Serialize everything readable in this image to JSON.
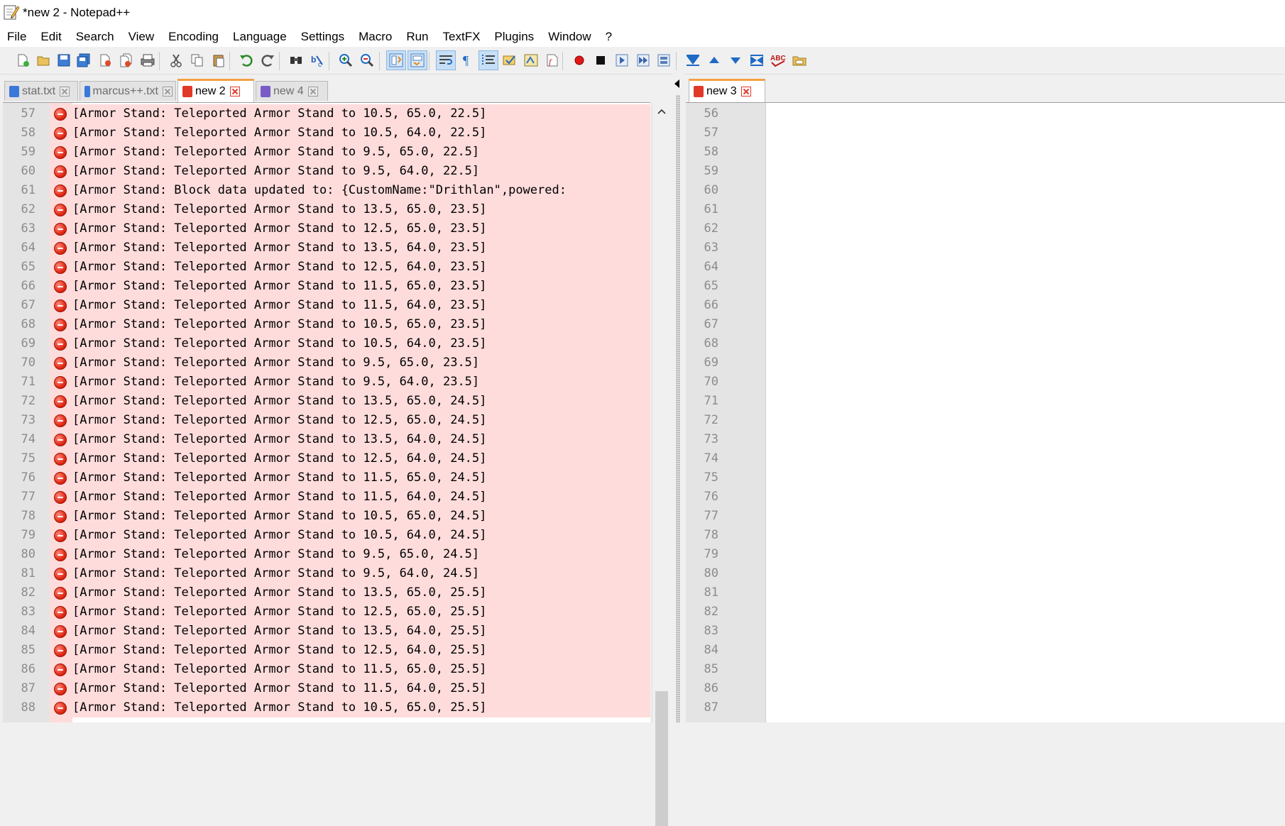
{
  "window": {
    "title": "*new  2 - Notepad++"
  },
  "menu": [
    "File",
    "Edit",
    "Search",
    "View",
    "Encoding",
    "Language",
    "Settings",
    "Macro",
    "Run",
    "TextFX",
    "Plugins",
    "Window",
    "?"
  ],
  "toolbar": {
    "icons": [
      "new-file-icon",
      "open-file-icon",
      "save-icon",
      "save-all-icon",
      "close-icon",
      "close-all-icon",
      "print-icon",
      "cut-icon",
      "copy-icon",
      "paste-icon",
      "undo-icon",
      "redo-icon",
      "find-icon",
      "replace-icon",
      "zoom-in-icon",
      "zoom-out-icon",
      "sync-vertical-icon",
      "sync-horizontal-icon",
      "word-wrap-icon",
      "show-all-characters-icon",
      "indent-guide-icon",
      "user-language-icon",
      "doc-map-icon",
      "function-list-icon",
      "record-macro-icon",
      "stop-macro-icon",
      "play-macro-icon",
      "run-macro-multiple-icon",
      "save-macro-icon",
      "tab-list-icon",
      "arrow-up-icon",
      "arrow-down-icon",
      "sum-icon",
      "spell-check-icon",
      "folder-icon"
    ],
    "spell_label": "ABC"
  },
  "tabs_left": [
    {
      "label": "stat.txt",
      "icon_color": "#3b78d8",
      "active": false
    },
    {
      "label": "marcus++.txt",
      "icon_color": "#3b78d8",
      "active": false
    },
    {
      "label": "new  2",
      "icon_color": "#e0392a",
      "active": true
    },
    {
      "label": "new  4",
      "icon_color": "#7a5cc7",
      "active": false
    }
  ],
  "tabs_right": [
    {
      "label": "new  3",
      "icon_color": "#e0392a",
      "active": true
    }
  ],
  "left_editor": {
    "lines": [
      {
        "num": "57",
        "text": "[Armor Stand: Teleported Armor Stand to 10.5, 65.0, 22.5]"
      },
      {
        "num": "58",
        "text": "[Armor Stand: Teleported Armor Stand to 10.5, 64.0, 22.5]"
      },
      {
        "num": "59",
        "text": "[Armor Stand: Teleported Armor Stand to 9.5, 65.0, 22.5]"
      },
      {
        "num": "60",
        "text": "[Armor Stand: Teleported Armor Stand to 9.5, 64.0, 22.5]"
      },
      {
        "num": "61",
        "text": "[Armor Stand: Block data updated to: {CustomName:\"Drithlan\",powered:"
      },
      {
        "num": "62",
        "text": "[Armor Stand: Teleported Armor Stand to 13.5, 65.0, 23.5]"
      },
      {
        "num": "63",
        "text": "[Armor Stand: Teleported Armor Stand to 12.5, 65.0, 23.5]"
      },
      {
        "num": "64",
        "text": "[Armor Stand: Teleported Armor Stand to 13.5, 64.0, 23.5]"
      },
      {
        "num": "65",
        "text": "[Armor Stand: Teleported Armor Stand to 12.5, 64.0, 23.5]"
      },
      {
        "num": "66",
        "text": "[Armor Stand: Teleported Armor Stand to 11.5, 65.0, 23.5]"
      },
      {
        "num": "67",
        "text": "[Armor Stand: Teleported Armor Stand to 11.5, 64.0, 23.5]"
      },
      {
        "num": "68",
        "text": "[Armor Stand: Teleported Armor Stand to 10.5, 65.0, 23.5]"
      },
      {
        "num": "69",
        "text": "[Armor Stand: Teleported Armor Stand to 10.5, 64.0, 23.5]"
      },
      {
        "num": "70",
        "text": "[Armor Stand: Teleported Armor Stand to 9.5, 65.0, 23.5]"
      },
      {
        "num": "71",
        "text": "[Armor Stand: Teleported Armor Stand to 9.5, 64.0, 23.5]"
      },
      {
        "num": "72",
        "text": "[Armor Stand: Teleported Armor Stand to 13.5, 65.0, 24.5]"
      },
      {
        "num": "73",
        "text": "[Armor Stand: Teleported Armor Stand to 12.5, 65.0, 24.5]"
      },
      {
        "num": "74",
        "text": "[Armor Stand: Teleported Armor Stand to 13.5, 64.0, 24.5]"
      },
      {
        "num": "75",
        "text": "[Armor Stand: Teleported Armor Stand to 12.5, 64.0, 24.5]"
      },
      {
        "num": "76",
        "text": "[Armor Stand: Teleported Armor Stand to 11.5, 65.0, 24.5]"
      },
      {
        "num": "77",
        "text": "[Armor Stand: Teleported Armor Stand to 11.5, 64.0, 24.5]"
      },
      {
        "num": "78",
        "text": "[Armor Stand: Teleported Armor Stand to 10.5, 65.0, 24.5]"
      },
      {
        "num": "79",
        "text": "[Armor Stand: Teleported Armor Stand to 10.5, 64.0, 24.5]"
      },
      {
        "num": "80",
        "text": "[Armor Stand: Teleported Armor Stand to 9.5, 65.0, 24.5]"
      },
      {
        "num": "81",
        "text": "[Armor Stand: Teleported Armor Stand to 9.5, 64.0, 24.5]"
      },
      {
        "num": "82",
        "text": "[Armor Stand: Teleported Armor Stand to 13.5, 65.0, 25.5]"
      },
      {
        "num": "83",
        "text": "[Armor Stand: Teleported Armor Stand to 12.5, 65.0, 25.5]"
      },
      {
        "num": "84",
        "text": "[Armor Stand: Teleported Armor Stand to 13.5, 64.0, 25.5]"
      },
      {
        "num": "85",
        "text": "[Armor Stand: Teleported Armor Stand to 12.5, 64.0, 25.5]"
      },
      {
        "num": "86",
        "text": "[Armor Stand: Teleported Armor Stand to 11.5, 65.0, 25.5]"
      },
      {
        "num": "87",
        "text": "[Armor Stand: Teleported Armor Stand to 11.5, 64.0, 25.5]"
      },
      {
        "num": "88",
        "text": "[Armor Stand: Teleported Armor Stand to 10.5, 65.0, 25.5]"
      }
    ]
  },
  "right_editor": {
    "lines": [
      "56",
      "57",
      "58",
      "59",
      "60",
      "61",
      "62",
      "63",
      "64",
      "65",
      "66",
      "67",
      "68",
      "69",
      "70",
      "71",
      "72",
      "73",
      "74",
      "75",
      "76",
      "77",
      "78",
      "79",
      "80",
      "81",
      "82",
      "83",
      "84",
      "85",
      "86",
      "87"
    ]
  },
  "colors": {
    "bookmarked_line_bg": "#ffdcdc",
    "gutter_bg": "#e4e4e4",
    "active_tab_accent": "#f5a142",
    "bookmark_red": "#e02a17"
  }
}
